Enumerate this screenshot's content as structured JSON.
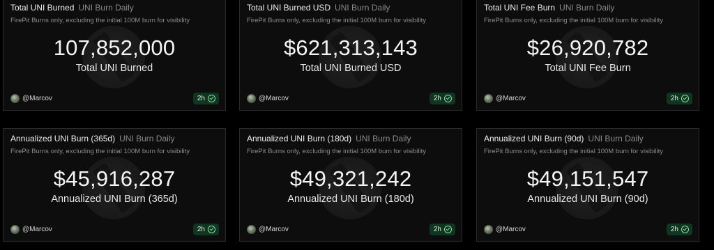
{
  "cards": [
    {
      "title": "Total UNI Burned",
      "source": "UNI Burn Daily",
      "description": "FirePit Burns only, excluding the initial 100M burn for visibility",
      "value": "107,852,000",
      "label": "Total UNI Burned",
      "author": "@Marcov",
      "age": "2h"
    },
    {
      "title": "Total UNI Burned USD",
      "source": "UNI Burn Daily",
      "description": "FirePit Burns only, excluding the initial 100M burn for visibility",
      "value": "$621,313,143",
      "label": "Total UNI Burned USD",
      "author": "@Marcov",
      "age": "2h"
    },
    {
      "title": "Total UNI Fee Burn",
      "source": "UNI Burn Daily",
      "description": "FirePit Burns only, excluding the initial 100M burn for visibility",
      "value": "$26,920,782",
      "label": "Total UNI Fee Burn",
      "author": "@Marcov",
      "age": "2h"
    },
    {
      "title": "Annualized UNI Burn (365d)",
      "source": "UNI Burn Daily",
      "description": "FirePit Burns only, excluding the initial 100M burn for visibility",
      "value": "$45,916,287",
      "label": "Annualized UNI Burn (365d)",
      "author": "@Marcov",
      "age": "2h"
    },
    {
      "title": "Annualized UNI Burn (180d)",
      "source": "UNI Burn Daily",
      "description": "FirePit Burns only, excluding the initial 100M burn for visibility",
      "value": "$49,321,242",
      "label": "Annualized UNI Burn (180d)",
      "author": "@Marcov",
      "age": "2h"
    },
    {
      "title": "Annualized UNI Burn (90d)",
      "source": "UNI Burn Daily",
      "description": "FirePit Burns only, excluding the initial 100M burn for visibility",
      "value": "$49,151,547",
      "label": "Annualized UNI Burn (90d)",
      "author": "@Marcov",
      "age": "2h"
    }
  ],
  "colors": {
    "background": "#000000",
    "card_background": "#0d0d0d",
    "card_border": "#2a2a2a",
    "badge_background": "#103520",
    "badge_check": "#8fe0a6"
  },
  "icons": {
    "avatar": "user-avatar",
    "badge": "check-circle-icon",
    "watermark": "dune-logo-watermark"
  }
}
